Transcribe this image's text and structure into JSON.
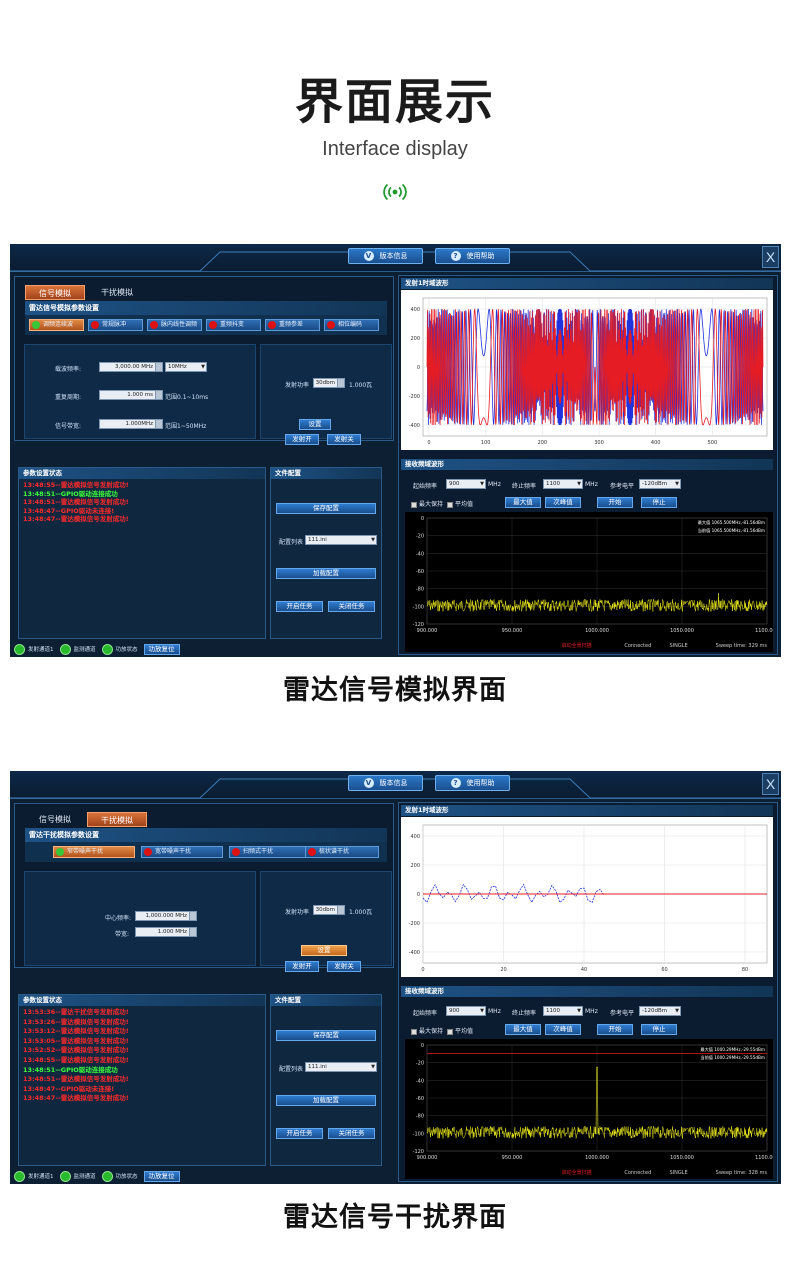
{
  "page": {
    "title": "界面展示",
    "subtitle": "Interface display",
    "logo_icon": "signal-broadcast-icon",
    "accent": "#1f9a2f"
  },
  "screens": [
    {
      "caption": "雷达信号模拟界面",
      "topbar": {
        "version_label": "版本信息",
        "help_label": "使用帮助",
        "close_label": "X"
      },
      "tabs": [
        {
          "label": "信号模拟",
          "active": true
        },
        {
          "label": "干扰模拟",
          "active": false
        }
      ],
      "params_title": "雷达信号模拟参数设置",
      "modes": [
        {
          "label": "调频连续波",
          "active": true
        },
        {
          "label": "常规脉冲",
          "active": false
        },
        {
          "label": "脉内线性调频",
          "active": false
        },
        {
          "label": "重频抖变",
          "active": false
        },
        {
          "label": "重频参差",
          "active": false
        },
        {
          "label": "相位编码",
          "active": false
        }
      ],
      "fields": [
        {
          "label": "载波频率:",
          "value": "3,000.00 MHz",
          "unit_select": "10MHz",
          "note": ""
        },
        {
          "label": "重复周期:",
          "value": "1.000 ms",
          "unit_select": "",
          "note": "范围0.1~10ms"
        },
        {
          "label": "信号带宽:",
          "value": "1.000MHz",
          "unit_select": "",
          "note": "范围1~50MHz"
        }
      ],
      "power": {
        "label": "发射功率",
        "value": "30dbm",
        "readout": "1.000瓦"
      },
      "buttons": {
        "set": "设置",
        "tx_on": "发射开",
        "tx_off": "发射关"
      },
      "status": {
        "title": "参数设置状态",
        "lines": [
          {
            "text": "13:48:55--雷达模拟信号发射成功!",
            "color": "#ff2a2a"
          },
          {
            "text": "13:48:51--GPIO驱动连接成功",
            "color": "#3cff3c"
          },
          {
            "text": "13:48:51--雷达模拟信号发射成功!",
            "color": "#ff2a2a"
          },
          {
            "text": "13:48:47--GPIO驱动未连接!",
            "color": "#ff2a2a"
          },
          {
            "text": "13:48:47--雷达模拟信号发射成功!",
            "color": "#ff2a2a"
          }
        ]
      },
      "file": {
        "title": "文件配置",
        "save": "保存配置",
        "list_label": "配置列表",
        "list_value": "111.ini",
        "load": "加载配置",
        "start_task": "开启任务",
        "stop_task": "关闭任务"
      },
      "indicators": [
        "发射通道1",
        "监测通道",
        "功放状态"
      ],
      "reset_label": "功放复位",
      "time_chart": {
        "title": "发射1时域波形",
        "xticks": [
          "0",
          "100",
          "200",
          "300",
          "400",
          "500"
        ],
        "yticks": [
          "400",
          "200",
          "0",
          "-200",
          "-400"
        ]
      },
      "spectrum": {
        "title": "接收频域波形",
        "start_label": "起始频率",
        "start_value": "900",
        "start_unit": "MHz",
        "stop_label": "终止频率",
        "stop_value": "1100",
        "stop_unit": "MHz",
        "ref_label": "参考电平",
        "ref_value": "-120dBm",
        "maxhold_label": "最大保持",
        "avg_label": "平均值",
        "btn_max": "最大值",
        "btn_next": "次峰值",
        "btn_start": "开始",
        "btn_stop": "停止",
        "legend_max": "最大值 1065.500MHz,-81.56dBm",
        "legend_cur": "当前值 1065.500MHz,-81.56dBm",
        "yticks": [
          "0",
          "-20",
          "-40",
          "-60",
          "-80",
          "-100",
          "-120"
        ],
        "xticks": [
          "900.000",
          "950.000",
          "1000.000",
          "1050.000",
          "1100.000"
        ],
        "footer_warn": "启动全景扫描",
        "footer_conn": "Connected",
        "footer_mode": "SINGLE",
        "footer_sweep": "Sweep time: 329 ms"
      }
    },
    {
      "caption": "雷达信号干扰界面",
      "topbar": {
        "version_label": "版本信息",
        "help_label": "使用帮助",
        "close_label": "X"
      },
      "tabs": [
        {
          "label": "信号模拟",
          "active": false
        },
        {
          "label": "干扰模拟",
          "active": true
        }
      ],
      "params_title": "雷达干扰模拟参数设置",
      "modes": [
        {
          "label": "窄带噪声干扰",
          "active": true
        },
        {
          "label": "宽带噪声干扰",
          "active": false
        },
        {
          "label": "扫频式干扰",
          "active": false
        },
        {
          "label": "梳状谱干扰",
          "active": false
        }
      ],
      "fields": [
        {
          "label": "中心频率:",
          "value": "1,000.000 MHz",
          "unit_select": "",
          "note": ""
        },
        {
          "label": "带宽:",
          "value": "1.000 MHz",
          "unit_select": "",
          "note": ""
        }
      ],
      "power": {
        "label": "发射功率",
        "value": "30dbm",
        "readout": "1.000瓦"
      },
      "buttons": {
        "set": "设置",
        "tx_on": "发射开",
        "tx_off": "发射关"
      },
      "status": {
        "title": "参数设置状态",
        "lines": [
          {
            "text": "13:53:36--雷达干扰信号发射成功!",
            "color": "#ff2a2a"
          },
          {
            "text": "13:53:26--雷达模拟信号发射成功!",
            "color": "#ff2a2a"
          },
          {
            "text": "13:53:12--雷达模拟信号发射成功!",
            "color": "#ff2a2a"
          },
          {
            "text": "13:53:05--雷达模拟信号发射成功!",
            "color": "#ff2a2a"
          },
          {
            "text": "13:52:52--雷达模拟信号发射成功!",
            "color": "#ff2a2a"
          },
          {
            "text": "13:48:55--雷达模拟信号发射成功!",
            "color": "#ff2a2a"
          },
          {
            "text": "13:48:51--GPIO驱动连接成功",
            "color": "#3cff3c"
          },
          {
            "text": "13:48:51--雷达模拟信号发射成功!",
            "color": "#ff2a2a"
          },
          {
            "text": "13:48:47--GPIO驱动未连接!",
            "color": "#ff2a2a"
          },
          {
            "text": "13:48:47--雷达模拟信号发射成功!",
            "color": "#ff2a2a"
          }
        ]
      },
      "file": {
        "title": "文件配置",
        "save": "保存配置",
        "list_label": "配置列表",
        "list_value": "111.ini",
        "load": "加载配置",
        "start_task": "开启任务",
        "stop_task": "关闭任务"
      },
      "indicators": [
        "发射通道1",
        "监测通道",
        "功放状态"
      ],
      "reset_label": "功放复位",
      "time_chart": {
        "title": "发射1时域波形",
        "xticks": [
          "0",
          "20",
          "40",
          "60",
          "80"
        ],
        "yticks": [
          "400",
          "200",
          "0",
          "-200",
          "-400"
        ]
      },
      "spectrum": {
        "title": "接收频域波形",
        "start_label": "起始频率",
        "start_value": "900",
        "start_unit": "MHz",
        "stop_label": "终止频率",
        "stop_value": "1100",
        "stop_unit": "MHz",
        "ref_label": "参考电平",
        "ref_value": "-120dBm",
        "maxhold_label": "最大保持",
        "avg_label": "平均值",
        "btn_max": "最大值",
        "btn_next": "次峰值",
        "btn_start": "开始",
        "btn_stop": "停止",
        "legend_max": "最大值 1000.29MHz,-29.55dBm",
        "legend_cur": "当前值 1000.29MHz,-29.55dBm",
        "yticks": [
          "0",
          "-20",
          "-40",
          "-60",
          "-80",
          "-100",
          "-120"
        ],
        "xticks": [
          "900.000",
          "950.000",
          "1000.000",
          "1050.000",
          "1100.000"
        ],
        "footer_warn": "启动全景扫描",
        "footer_conn": "Connected",
        "footer_mode": "SINGLE",
        "footer_sweep": "Sweep time: 328 ms"
      }
    }
  ]
}
